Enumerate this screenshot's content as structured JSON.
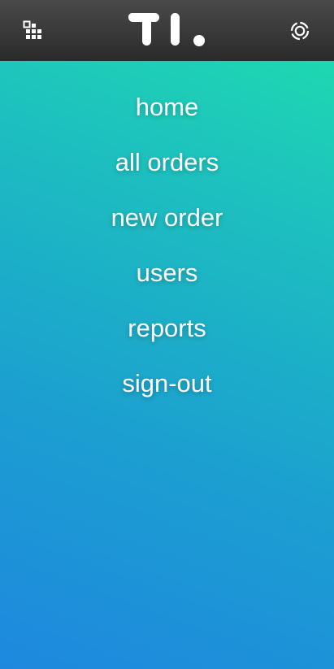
{
  "header": {
    "apps_icon": "grid-apps-icon",
    "logo_icon": "brand-logo",
    "settings_icon": "settings-target-icon"
  },
  "menu": {
    "items": [
      {
        "label": "home"
      },
      {
        "label": "all orders"
      },
      {
        "label": "new order"
      },
      {
        "label": "users"
      },
      {
        "label": "reports"
      },
      {
        "label": "sign-out"
      }
    ]
  },
  "colors": {
    "header_bg": "#333333",
    "gradient_top": "#1fe0ac",
    "gradient_bottom": "#1e88de",
    "text": "#ffffff"
  }
}
